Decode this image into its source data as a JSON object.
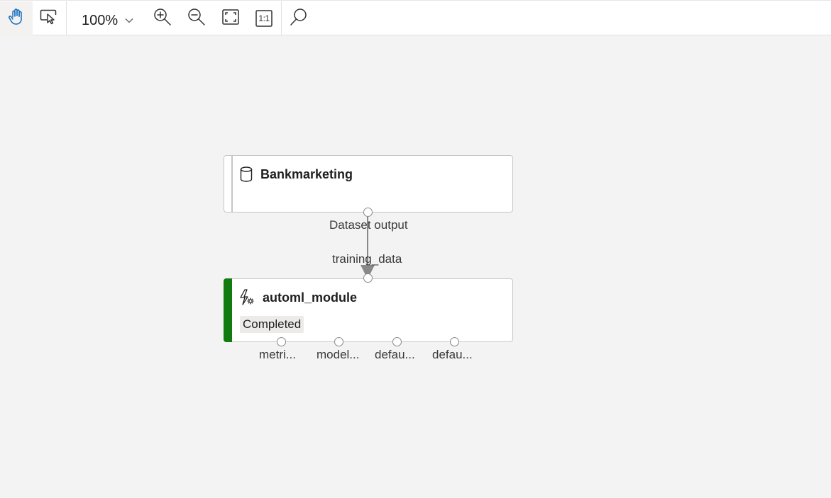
{
  "toolbar": {
    "pan_tool": {
      "icon": "hand-icon",
      "active": true
    },
    "select_tool": {
      "icon": "pointer-select-icon"
    },
    "zoom": {
      "value": "100%"
    },
    "zoom_in": {
      "icon": "zoom-in-icon"
    },
    "zoom_out": {
      "icon": "zoom-out-icon"
    },
    "fit_to_screen": {
      "icon": "fit-screen-icon"
    },
    "actual_size": {
      "icon": "actual-size-icon",
      "label": "1:1"
    },
    "search": {
      "icon": "search-icon"
    }
  },
  "colors": {
    "accent": "#0f6cbd",
    "status_completed": "#107c10",
    "canvas_bg": "#f3f3f3",
    "edge": "#8a8886"
  },
  "nodes": {
    "bankmarketing": {
      "title": "Bankmarketing",
      "icon": "database-icon",
      "output_port_label": "Dataset output"
    },
    "automl": {
      "title": "automl_module",
      "icon": "automl-lightning-gear-icon",
      "status": "Completed",
      "input_port_label": "training_data",
      "output_ports": [
        "metri...",
        "model...",
        "defau...",
        "defau..."
      ]
    }
  }
}
